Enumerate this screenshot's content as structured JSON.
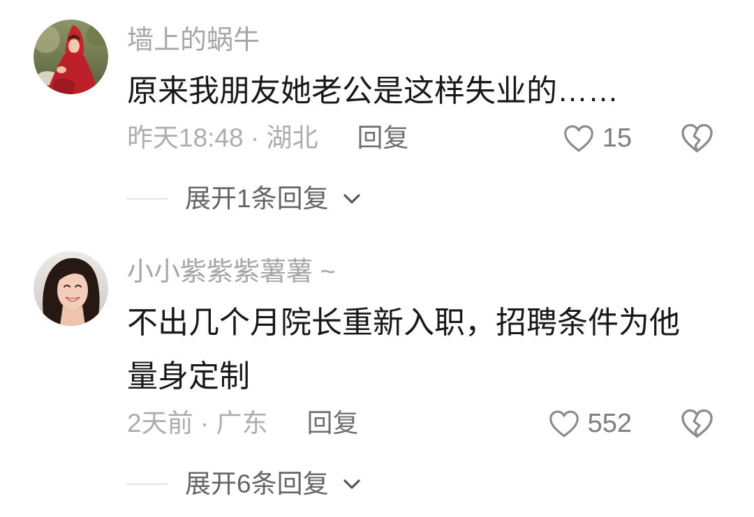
{
  "comments": [
    {
      "username": "墙上的蜗牛",
      "text_lines": [
        "原来我朋友她老公是这样失业的……"
      ],
      "meta": "昨天18:48 · 湖北",
      "reply_label": "回复",
      "like_count": "15",
      "expand_label": "展开1条回复"
    },
    {
      "username": "小小紫紫紫薯薯 ~",
      "text_lines": [
        "不出几个月院长重新入职，招聘条件为他",
        "量身定制"
      ],
      "meta": "2天前 · 广东",
      "reply_label": "回复",
      "like_count": "552",
      "expand_label": "展开6条回复"
    }
  ],
  "icons": {
    "like": "heart-outline-icon",
    "dislike": "broken-heart-icon",
    "expand": "chevron-down-icon"
  },
  "colors": {
    "background": "#ffffff",
    "comment_text": "#181818",
    "username": "#a6a6a6",
    "meta": "#adadad",
    "reply": "#6f6f6f",
    "icon": "#8a8a8a",
    "expand_label": "#646464"
  }
}
